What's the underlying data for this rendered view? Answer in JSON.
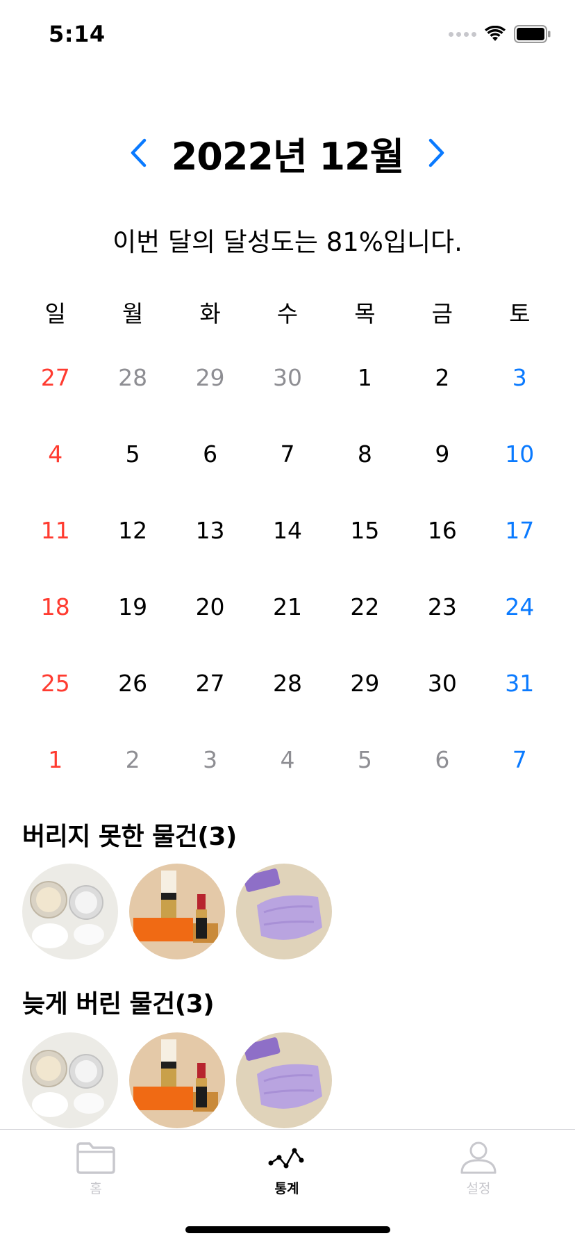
{
  "status_bar": {
    "time": "5:14"
  },
  "header": {
    "month_title": "2022년 12월"
  },
  "summary": {
    "achievement_text": "이번 달의 달성도는 81%입니다."
  },
  "calendar": {
    "weekdays": [
      "일",
      "월",
      "화",
      "수",
      "목",
      "금",
      "토"
    ],
    "weeks": [
      [
        {
          "d": "27",
          "c": "red"
        },
        {
          "d": "28",
          "c": "gray"
        },
        {
          "d": "29",
          "c": "gray"
        },
        {
          "d": "30",
          "c": "gray"
        },
        {
          "d": "1",
          "c": "black"
        },
        {
          "d": "2",
          "c": "black"
        },
        {
          "d": "3",
          "c": "blue"
        }
      ],
      [
        {
          "d": "4",
          "c": "red"
        },
        {
          "d": "5",
          "c": "black"
        },
        {
          "d": "6",
          "c": "black"
        },
        {
          "d": "7",
          "c": "black"
        },
        {
          "d": "8",
          "c": "black"
        },
        {
          "d": "9",
          "c": "black"
        },
        {
          "d": "10",
          "c": "blue"
        }
      ],
      [
        {
          "d": "11",
          "c": "red"
        },
        {
          "d": "12",
          "c": "black"
        },
        {
          "d": "13",
          "c": "black"
        },
        {
          "d": "14",
          "c": "black"
        },
        {
          "d": "15",
          "c": "black"
        },
        {
          "d": "16",
          "c": "black"
        },
        {
          "d": "17",
          "c": "blue"
        }
      ],
      [
        {
          "d": "18",
          "c": "red"
        },
        {
          "d": "19",
          "c": "black"
        },
        {
          "d": "20",
          "c": "black"
        },
        {
          "d": "21",
          "c": "black"
        },
        {
          "d": "22",
          "c": "black"
        },
        {
          "d": "23",
          "c": "black"
        },
        {
          "d": "24",
          "c": "blue"
        }
      ],
      [
        {
          "d": "25",
          "c": "red"
        },
        {
          "d": "26",
          "c": "black"
        },
        {
          "d": "27",
          "c": "black"
        },
        {
          "d": "28",
          "c": "black"
        },
        {
          "d": "29",
          "c": "black"
        },
        {
          "d": "30",
          "c": "black"
        },
        {
          "d": "31",
          "c": "blue"
        }
      ],
      [
        {
          "d": "1",
          "c": "red"
        },
        {
          "d": "2",
          "c": "gray"
        },
        {
          "d": "3",
          "c": "gray"
        },
        {
          "d": "4",
          "c": "gray"
        },
        {
          "d": "5",
          "c": "gray"
        },
        {
          "d": "6",
          "c": "gray"
        },
        {
          "d": "7",
          "c": "blue"
        }
      ]
    ]
  },
  "sections": [
    {
      "title": "버리지 못한 물건(3)",
      "items": [
        "compact-powder",
        "lipstick",
        "lavender-mask"
      ]
    },
    {
      "title": "늦게 버린 물건(3)",
      "items": [
        "compact-powder",
        "lipstick",
        "lavender-mask"
      ]
    }
  ],
  "tab_bar": {
    "tabs": [
      {
        "label": "홈",
        "icon": "folder-icon",
        "active": false
      },
      {
        "label": "통계",
        "icon": "line-chart-icon",
        "active": true
      },
      {
        "label": "설정",
        "icon": "person-icon",
        "active": false
      }
    ]
  },
  "colors": {
    "accent": "#0a7aff",
    "sunday": "#ff3b30",
    "saturday": "#0a7aff",
    "muted": "#8e8e93",
    "tab_inactive": "#c8c8cd"
  }
}
